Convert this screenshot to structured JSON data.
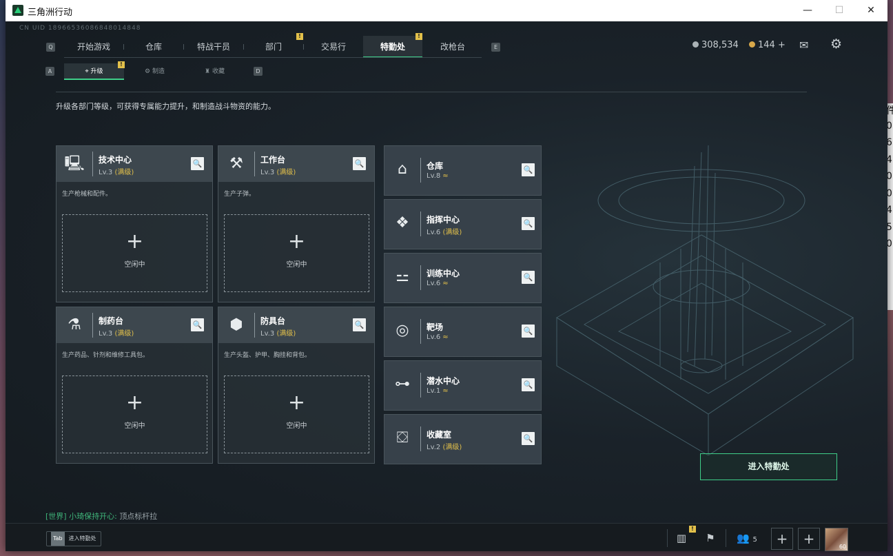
{
  "window": {
    "title": "三角洲行动",
    "minimize": "—",
    "maximize": "☐",
    "close": "✕"
  },
  "desktop_strip": [
    "件",
    "0",
    "6",
    "4",
    "0",
    "0",
    "4",
    "5",
    "0"
  ],
  "uid": "CN UID 18966536086848014848",
  "nav": {
    "left_key": "Q",
    "right_key": "E",
    "items": [
      {
        "label": "开始游戏"
      },
      {
        "label": "仓库"
      },
      {
        "label": "特战干员"
      },
      {
        "label": "部门",
        "badge": "!"
      },
      {
        "label": "交易行"
      },
      {
        "label": "特勤处",
        "badge": "!",
        "active": true
      },
      {
        "label": "改枪台"
      }
    ]
  },
  "currency": {
    "coins": "308,534",
    "premium": "144 +",
    "mail_icon": "mail-icon",
    "settings_icon": "gear-icon"
  },
  "subnav": {
    "left_key": "A",
    "right_key": "D",
    "items": [
      {
        "label": "升级",
        "badge": "!",
        "active": true
      },
      {
        "label": "制造"
      },
      {
        "label": "收藏"
      }
    ]
  },
  "description": "升级各部门等级，可获得专属能力提升，和制造战斗物资的能力。",
  "big_cards": [
    {
      "name": "技术中心",
      "level": "Lv.3",
      "max": "(满级)",
      "desc": "生产枪械和配件。",
      "icon": "computer-icon",
      "plus": "+",
      "idle": "空闲中"
    },
    {
      "name": "工作台",
      "level": "Lv.3",
      "max": "(满级)",
      "desc": "生产子弹。",
      "icon": "tools-icon",
      "plus": "+",
      "idle": "空闲中"
    },
    {
      "name": "制药台",
      "level": "Lv.3",
      "max": "(满级)",
      "desc": "生产药品、针剂和维修工具包。",
      "icon": "microscope-icon",
      "plus": "+",
      "idle": "空闲中"
    },
    {
      "name": "防具台",
      "level": "Lv.3",
      "max": "(满级)",
      "desc": "生产头盔、护甲、胸挂和背包。",
      "icon": "armor-icon",
      "plus": "+",
      "idle": "空闲中"
    }
  ],
  "small_cards": [
    {
      "name": "仓库",
      "level": "Lv.8",
      "max": "",
      "up": "≈",
      "icon": "warehouse-icon"
    },
    {
      "name": "指挥中心",
      "level": "Lv.6",
      "max": "(满级)",
      "up": "",
      "icon": "command-icon"
    },
    {
      "name": "训练中心",
      "level": "Lv.6",
      "max": "",
      "up": "≈",
      "icon": "dumbbell-icon"
    },
    {
      "name": "靶场",
      "level": "Lv.6",
      "max": "",
      "up": "≈",
      "icon": "target-icon"
    },
    {
      "name": "潜水中心",
      "level": "Lv.1",
      "max": "",
      "up": "≈",
      "icon": "goggles-icon"
    },
    {
      "name": "收藏室",
      "level": "Lv.2",
      "max": "(满级)",
      "up": "",
      "icon": "collection-icon"
    }
  ],
  "enter_button": "进入特勤处",
  "chat": {
    "channel": "[世界]",
    "user": "小琦保持开心:",
    "message": "顶点标杆拉"
  },
  "bottom": {
    "tab_key": "Tab",
    "tab_label": "进入特勤处",
    "friends_count": "5",
    "stats_badge": "!",
    "avatar_level": "60"
  },
  "colors": {
    "accent": "#3fd08a",
    "gold": "#e2c04a",
    "bg": "#1b2126"
  }
}
